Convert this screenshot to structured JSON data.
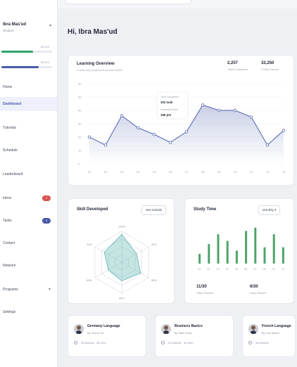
{
  "sidebar": {
    "profile": {
      "name": "Ibra Mas'ud",
      "role": "Student"
    },
    "progress": [
      {
        "label": "62/100",
        "value": 0.62,
        "color": "#2fa568"
      },
      {
        "label": "52/100",
        "value": 0.74,
        "color": "#4a5aa8"
      }
    ],
    "items": [
      {
        "label": "Home",
        "active": false
      },
      {
        "label": "Dashboard",
        "active": true
      },
      {
        "label": "Tutorials",
        "active": false
      },
      {
        "label": "Schedule",
        "active": false
      },
      {
        "label": "Leaderboard",
        "active": false
      },
      {
        "label": "Inbox",
        "active": false,
        "badge": "2",
        "badge_color": "#d9534f"
      },
      {
        "label": "Tasks",
        "active": false,
        "badge": "4",
        "badge_color": "#4a5aa8"
      },
      {
        "label": "Contact",
        "active": false
      },
      {
        "label": "Network",
        "active": false
      },
      {
        "label": "Programs",
        "active": false,
        "chevron": true
      },
      {
        "label": "Settings",
        "active": false
      }
    ]
  },
  "greeting": "Hi, Ibra Mas'ud",
  "learning_overview": {
    "title": "Learning Overview",
    "subtitle": "A sixty-day progress from last month",
    "stats": [
      {
        "value": "2,257",
        "label": "Total Completed"
      },
      {
        "value": "32,250",
        "label": "Points Earned"
      }
    ],
    "tooltip": {
      "line1_label": "Total Completed",
      "line1_value": "322 task",
      "line2_label": "Learning Hours",
      "line2_value": "180 pts"
    },
    "chart_data": {
      "type": "area",
      "categories": [
        "01",
        "02",
        "03",
        "04",
        "05",
        "06",
        "07",
        "08",
        "09",
        "10",
        "11",
        "12",
        "13"
      ],
      "values": [
        20,
        14,
        36,
        27,
        22,
        16,
        24,
        44,
        40,
        40,
        35,
        14,
        25
      ],
      "y_ticks": [
        "60",
        "50",
        "40",
        "30",
        "20",
        "10",
        "0"
      ],
      "ylim": [
        0,
        60
      ],
      "color": "#6877b8"
    }
  },
  "skill": {
    "title": "Skill Developed",
    "button": "See Details",
    "chart_data": {
      "type": "radar",
      "axes": [
        "Coding",
        "Design",
        "Research",
        "Writing",
        "Speaking",
        "Analysis"
      ],
      "tick_labels": [
        "100%",
        "80%",
        "80%",
        "60%",
        "60%",
        "40%"
      ],
      "values": [
        0.9,
        0.55,
        0.7,
        0.6,
        0.5,
        0.65
      ],
      "color": "#59b5b0"
    }
  },
  "study": {
    "title": "Study Time",
    "button": "Monthly",
    "chart_data": {
      "type": "bar",
      "categories": [
        "01",
        "02",
        "03",
        "04",
        "05",
        "06",
        "07",
        "08",
        "09",
        "10"
      ],
      "values": [
        3,
        6,
        9,
        7,
        4,
        10,
        11,
        5,
        9,
        5
      ],
      "ylim": [
        0,
        12
      ],
      "color": "#4ea36a"
    },
    "stats": [
      {
        "value": "11/30",
        "label": "Days Studied"
      },
      {
        "value": "6/30",
        "label": "Days Missed"
      }
    ]
  },
  "courses": [
    {
      "title": "Germany Language",
      "subtitle": "By Jenny Tut",
      "meta": "28 Module · 6h 12m"
    },
    {
      "title": "Business Basics",
      "subtitle": "By Mike Ross",
      "meta": "20 Module · 4h 40m"
    },
    {
      "title": "French Language",
      "subtitle": "By Lea Martin",
      "meta": "16 Module"
    }
  ]
}
